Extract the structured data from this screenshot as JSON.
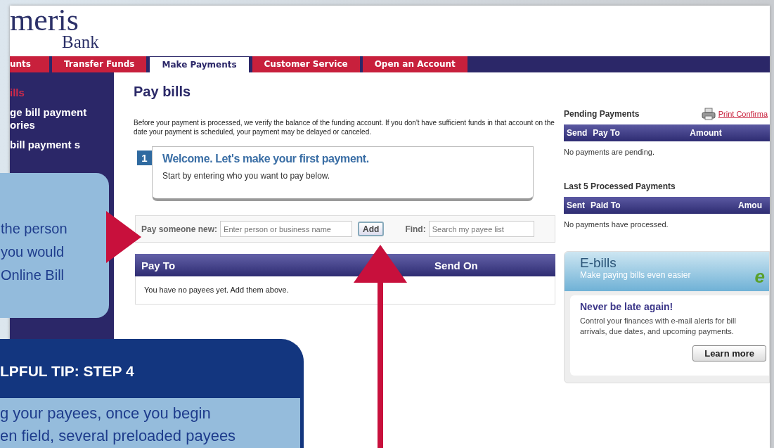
{
  "logo": {
    "name": "meris",
    "sub": "Bank"
  },
  "nav_tabs": [
    {
      "label": "unts",
      "selected": false
    },
    {
      "label": "Transfer Funds",
      "selected": false
    },
    {
      "label": "Make Payments",
      "selected": true
    },
    {
      "label": "Customer Service",
      "selected": false
    },
    {
      "label": "Open an Account",
      "selected": false
    }
  ],
  "sidebar": {
    "items": [
      {
        "label": "ills",
        "selected": true
      },
      {
        "label": "ge bill payment ories",
        "selected": false
      },
      {
        "label": "bill payment s",
        "selected": false
      }
    ]
  },
  "main": {
    "title": "Pay bills",
    "notice": "Before your payment is processed, we verify the balance of the funding account. If you don't have sufficient funds in that account on the date your payment is scheduled, your payment may be delayed or canceled.",
    "welcome": {
      "step": "1",
      "heading": "Welcome. Let's make your first payment.",
      "text": "Start by entering who you want to pay below."
    },
    "payee_bar": {
      "new_label": "Pay someone new:",
      "new_placeholder": "Enter person or business name",
      "add_button": "Add",
      "find_label": "Find:",
      "find_placeholder": "Search my payee list"
    },
    "payee_table": {
      "columns": [
        "Pay To",
        "Send On"
      ],
      "empty_message": "You have no payees yet. Add them above."
    }
  },
  "pending": {
    "title": "Pending Payments",
    "print_link": "Print Confirma",
    "columns": [
      "Send",
      "Pay To",
      "Amount"
    ],
    "empty_message": "No payments are pending."
  },
  "processed": {
    "title": "Last 5 Processed Payments",
    "columns": [
      "Sent",
      "Paid To",
      "Amou"
    ],
    "empty_message": "No payments have processed."
  },
  "ebills": {
    "title": "E-bills",
    "subtitle": "Make paying bills even easier",
    "badge": "e",
    "heading": "Never be late again!",
    "text": "Control your finances with e-mail alerts for bill arrivals, due dates, and upcoming payments.",
    "button": "Learn more"
  },
  "callout": {
    "lines": [
      "the person",
      "you would",
      "Online Bill"
    ]
  },
  "tip": {
    "heading": "LPFUL TIP: STEP 4",
    "lines": [
      "g your payees, once you begin",
      "en field, several preloaded payees"
    ]
  }
}
